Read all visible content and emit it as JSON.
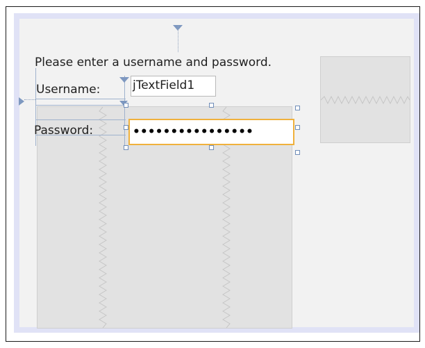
{
  "form": {
    "instruction_text": "Please enter a username and password.",
    "username_label": "Username:",
    "username_field_value": "jTextField1",
    "password_label": "Password:",
    "password_field_value": "••••••••••••••••"
  },
  "colors": {
    "selection_border": "#f0b13c",
    "frame_border": "#e0e2f6",
    "guide_color": "#6f8db8",
    "placeholder_fill": "#e2e2e2"
  },
  "icons": {
    "anchor_top": "anchor-triangle-down-icon",
    "anchor_left": "anchor-triangle-right-icon",
    "resize_handle": "resize-handle-icon",
    "zigzag": "zigzag-resizable-icon"
  }
}
